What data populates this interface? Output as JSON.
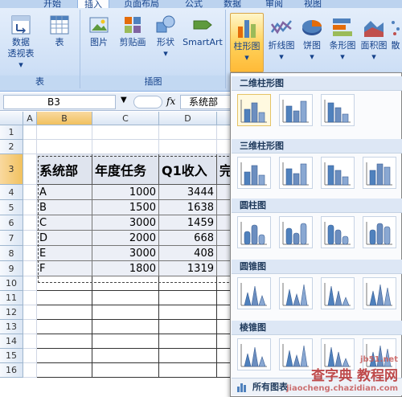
{
  "ribbon": {
    "tabs": [
      "开始",
      "插入",
      "页面布局",
      "公式",
      "数据",
      "审阅",
      "视图"
    ],
    "active_tab": "插入",
    "groups": {
      "table": {
        "label": "表",
        "pivot_label_1": "数据",
        "pivot_label_2": "透视表",
        "table_label": "表"
      },
      "illustrations": {
        "label": "插图",
        "picture": "图片",
        "clipart": "剪贴画",
        "shapes": "形状",
        "smartart": "SmartArt"
      },
      "charts": {
        "column": "柱形图",
        "line": "折线图",
        "pie": "饼图",
        "bar": "条形图",
        "area": "面积图",
        "scatter": "散"
      }
    }
  },
  "formula_bar": {
    "name_box": "B3",
    "fx": "fx",
    "value": "系统部"
  },
  "sheet": {
    "columns": [
      "A",
      "B",
      "C",
      "D"
    ],
    "rows": [
      "1",
      "2",
      "3",
      "4",
      "5",
      "6",
      "7",
      "8",
      "9",
      "10",
      "11",
      "12",
      "13",
      "14",
      "15",
      "16"
    ],
    "table_headers": [
      "系统部",
      "年度任务",
      "Q1收入",
      "完"
    ],
    "table_rows": [
      [
        "A",
        "1000",
        "3444"
      ],
      [
        "B",
        "1500",
        "1638"
      ],
      [
        "C",
        "3000",
        "1459"
      ],
      [
        "D",
        "2000",
        "668"
      ],
      [
        "E",
        "3000",
        "408"
      ],
      [
        "F",
        "1800",
        "1319"
      ]
    ]
  },
  "gallery": {
    "sections": [
      "二维柱形图",
      "三维柱形图",
      "圆柱图",
      "圆锥图",
      "棱锥图"
    ],
    "footer": "所有图表",
    "watermark_line1": "jb51.net",
    "watermark_line2": "查字典 教程网",
    "watermark_line3": "jiaocheng.chazidian.com"
  },
  "colors": {
    "accent": "#f1c15f",
    "ribbon": "#cfe0f6",
    "table_header_bg": "#dfe4ee"
  }
}
